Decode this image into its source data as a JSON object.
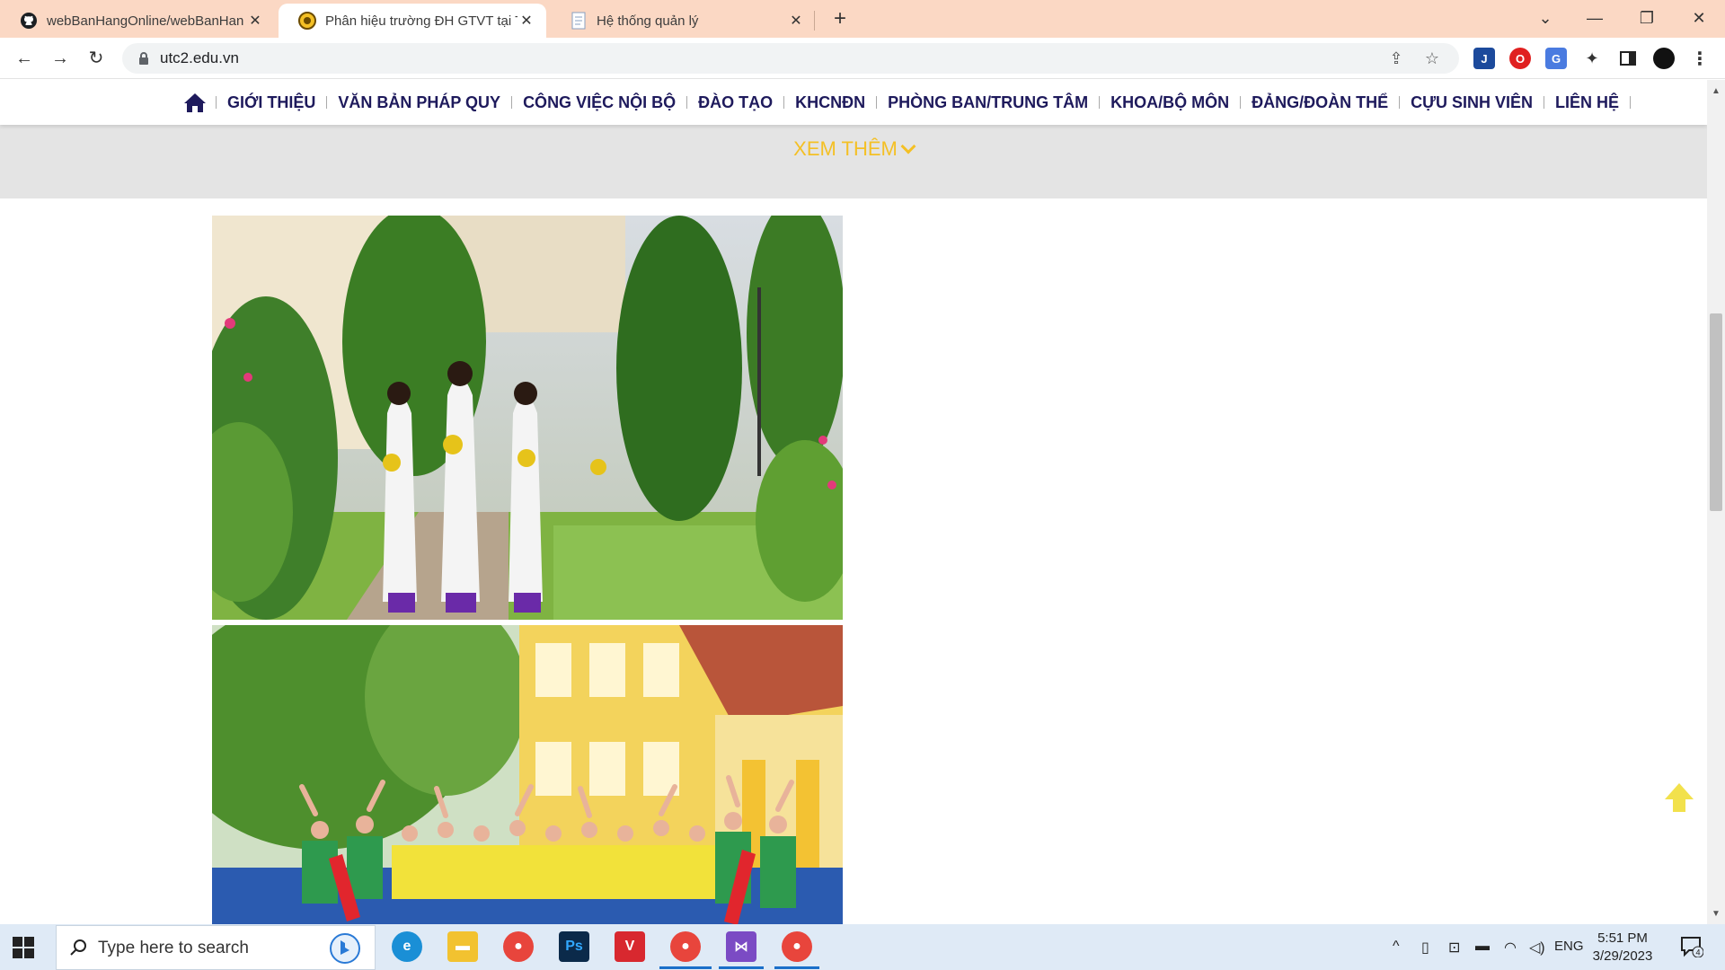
{
  "browser": {
    "tabs": [
      {
        "title": "webBanHangOnline/webBanHan"
      },
      {
        "title": "Phân hiệu trường ĐH GTVT tại TP"
      },
      {
        "title": "Hệ thống quản lý"
      }
    ],
    "new_tab": "+",
    "url": "utc2.edu.vn"
  },
  "site_nav": {
    "items": [
      "GIỚI THIỆU",
      "VĂN BẢN PHÁP QUY",
      "CÔNG VIỆC NỘI BỘ",
      "ĐÀO TẠO",
      "KHCNĐN",
      "PHÒNG BAN/TRUNG TÂM",
      "KHOA/BỘ MÔN",
      "ĐẢNG/ĐOÀN THỂ",
      "CỰU SINH VIÊN",
      "LIÊN HỆ"
    ],
    "more": "XEM THÊM"
  },
  "colors": {
    "nav_text": "#1e1a5c",
    "accent_yellow": "#f4c025",
    "tabstrip": "#fbd8c4"
  },
  "taskbar": {
    "search_placeholder": "Type here to search",
    "language": "ENG",
    "time": "5:51 PM",
    "date": "3/29/2023",
    "notifications": "4"
  }
}
